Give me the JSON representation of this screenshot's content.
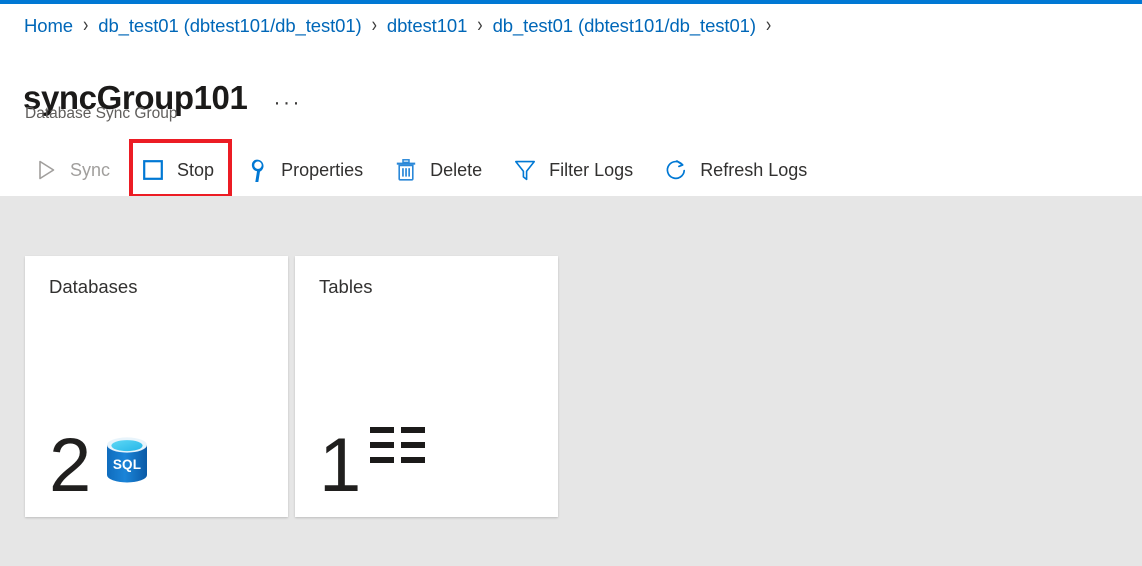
{
  "theme": {
    "accent": "#0078d4",
    "link": "#0067b8",
    "highlight": "#ec1c24",
    "canvas_bg": "#e6e6e6",
    "tile_bg": "#ffffff",
    "text": "#323130",
    "disabled_text": "#a19f9d"
  },
  "breadcrumb": {
    "separator": "›",
    "items": [
      {
        "label": "Home"
      },
      {
        "label": "db_test01 (dbtest101/db_test01)"
      },
      {
        "label": "dbtest101"
      },
      {
        "label": "db_test01 (dbtest101/db_test01)"
      }
    ],
    "trailing_separator": "›"
  },
  "header": {
    "title": "syncGroup101",
    "subtitle": "Database Sync Group",
    "more_menu": "···"
  },
  "commandbar": {
    "commands": [
      {
        "id": "sync",
        "label": "Sync",
        "icon": "play-icon",
        "disabled": true,
        "highlighted": false
      },
      {
        "id": "stop",
        "label": "Stop",
        "icon": "stop-icon",
        "disabled": false,
        "highlighted": true
      },
      {
        "id": "properties",
        "label": "Properties",
        "icon": "wrench-icon",
        "disabled": false,
        "highlighted": false
      },
      {
        "id": "delete",
        "label": "Delete",
        "icon": "trash-icon",
        "disabled": false,
        "highlighted": false
      },
      {
        "id": "filter-logs",
        "label": "Filter Logs",
        "icon": "funnel-icon",
        "disabled": false,
        "highlighted": false
      },
      {
        "id": "refresh-logs",
        "label": "Refresh Logs",
        "icon": "refresh-icon",
        "disabled": false,
        "highlighted": false
      }
    ]
  },
  "tiles": [
    {
      "id": "databases",
      "title": "Databases",
      "value": "2",
      "icon": "sql-database-icon"
    },
    {
      "id": "tables",
      "title": "Tables",
      "value": "1",
      "icon": "table-grid-icon"
    }
  ]
}
